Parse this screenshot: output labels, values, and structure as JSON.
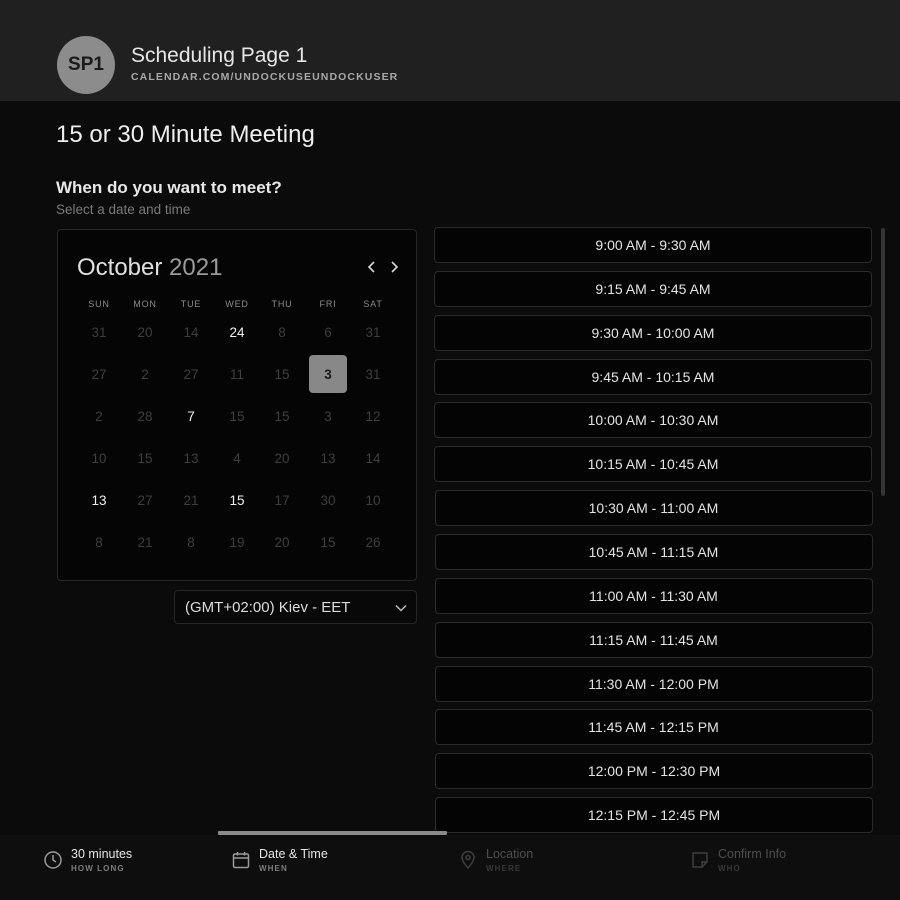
{
  "header": {
    "avatar_initials": "SP1",
    "page_name": "Scheduling Page 1",
    "page_url": "CALENDAR.COM/UNDOCKUSEUNDOCKUSER"
  },
  "meeting": {
    "title": "15 or 30 Minute Meeting",
    "question": "When do you want to meet?",
    "hint": "Select a date and time"
  },
  "calendar": {
    "month": "October",
    "year": "2021",
    "weekdays": [
      "SUN",
      "MON",
      "TUE",
      "WED",
      "THU",
      "FRI",
      "SAT"
    ],
    "weeks": [
      [
        {
          "d": "31",
          "s": "dim"
        },
        {
          "d": "20",
          "s": "dim"
        },
        {
          "d": "14",
          "s": "dim"
        },
        {
          "d": "24",
          "s": "on"
        },
        {
          "d": "8",
          "s": "dim"
        },
        {
          "d": "6",
          "s": "dim"
        },
        {
          "d": "31",
          "s": "dim"
        }
      ],
      [
        {
          "d": "27",
          "s": "dim"
        },
        {
          "d": "2",
          "s": "dim"
        },
        {
          "d": "27",
          "s": "dim"
        },
        {
          "d": "11",
          "s": "dim"
        },
        {
          "d": "15",
          "s": "dim"
        },
        {
          "d": "3",
          "s": "sel"
        },
        {
          "d": "31",
          "s": "dim"
        }
      ],
      [
        {
          "d": "2",
          "s": "dim"
        },
        {
          "d": "28",
          "s": "dim"
        },
        {
          "d": "7",
          "s": "on"
        },
        {
          "d": "15",
          "s": "dim"
        },
        {
          "d": "15",
          "s": "dim"
        },
        {
          "d": "3",
          "s": "dim"
        },
        {
          "d": "12",
          "s": "dim"
        }
      ],
      [
        {
          "d": "10",
          "s": "dim"
        },
        {
          "d": "15",
          "s": "dim"
        },
        {
          "d": "13",
          "s": "dim"
        },
        {
          "d": "4",
          "s": "dim"
        },
        {
          "d": "20",
          "s": "dim"
        },
        {
          "d": "13",
          "s": "dim"
        },
        {
          "d": "14",
          "s": "dim"
        }
      ],
      [
        {
          "d": "13",
          "s": "on"
        },
        {
          "d": "27",
          "s": "dim"
        },
        {
          "d": "21",
          "s": "dim"
        },
        {
          "d": "15",
          "s": "on"
        },
        {
          "d": "17",
          "s": "dim"
        },
        {
          "d": "30",
          "s": "dim"
        },
        {
          "d": "10",
          "s": "dim"
        }
      ],
      [
        {
          "d": "8",
          "s": "dim"
        },
        {
          "d": "21",
          "s": "dim"
        },
        {
          "d": "8",
          "s": "dim"
        },
        {
          "d": "19",
          "s": "dim"
        },
        {
          "d": "20",
          "s": "dim"
        },
        {
          "d": "15",
          "s": "dim"
        },
        {
          "d": "26",
          "s": "dim"
        }
      ]
    ]
  },
  "timezone": {
    "label": "(GMT+02:00) Kiev - EET"
  },
  "slots": [
    "9:00 AM - 9:30 AM",
    "9:15 AM - 9:45 AM",
    "9:30 AM - 10:00 AM",
    "9:45 AM - 10:15 AM",
    "10:00 AM - 10:30 AM",
    "10:15 AM - 10:45 AM",
    "10:30 AM - 11:00 AM",
    "10:45 AM - 11:15 AM",
    "11:00 AM - 11:30 AM",
    "11:15 AM - 11:45 AM",
    "11:30 AM - 12:00 PM",
    "11:45 AM - 12:15 PM",
    "12:00 PM - 12:30 PM",
    "12:15 PM - 12:45 PM"
  ],
  "steps": [
    {
      "title": "30 minutes",
      "sub": "HOW LONG",
      "icon": "clock-icon",
      "state": "active"
    },
    {
      "title": "Date & Time",
      "sub": "WHEN",
      "icon": "calendar-icon",
      "state": "active"
    },
    {
      "title": "Location",
      "sub": "WHERE",
      "icon": "location-pin-icon",
      "state": "inactive"
    },
    {
      "title": "Confirm Info",
      "sub": "WHO",
      "icon": "note-icon",
      "state": "inactive"
    }
  ]
}
